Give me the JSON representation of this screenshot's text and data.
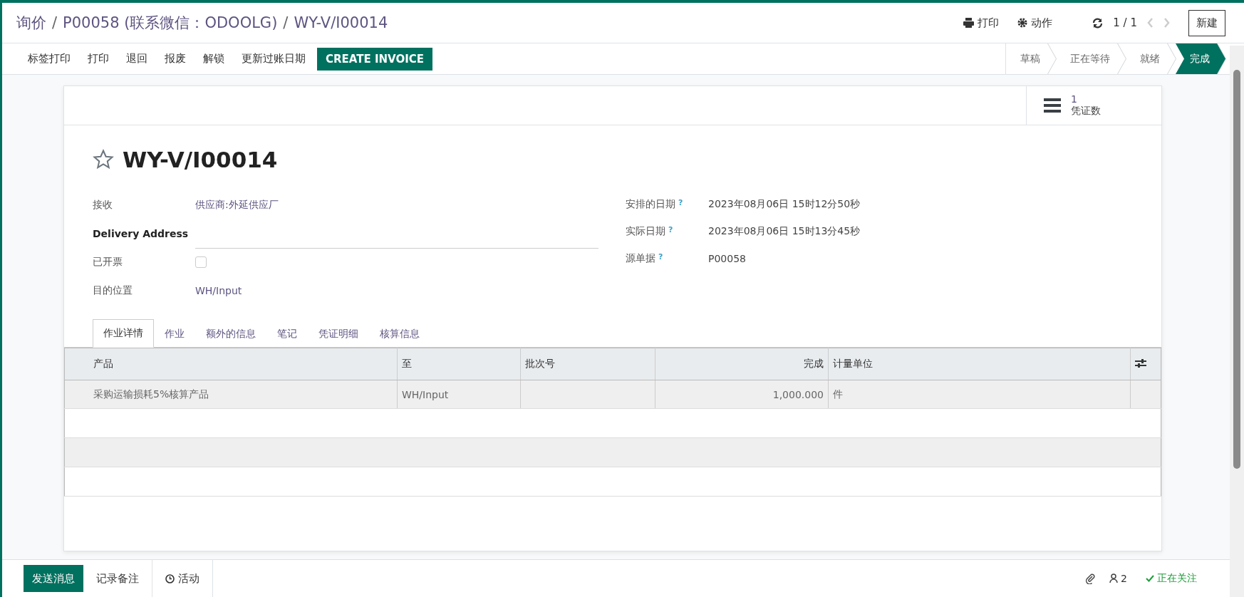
{
  "breadcrumb": {
    "separator": "/",
    "items": [
      {
        "label": "询价"
      },
      {
        "label": "P00058 (联系微信：ODOOLG)"
      },
      {
        "label": "WY-V/I00014"
      }
    ]
  },
  "header_actions": [
    {
      "kind": "print",
      "label": "打印"
    },
    {
      "kind": "gear",
      "label": "动作"
    }
  ],
  "pager": {
    "value": "1 / 1"
  },
  "new_button": "新建",
  "action_buttons": [
    {
      "label": "标签打印",
      "kind": "plain"
    },
    {
      "label": "打印",
      "kind": "plain"
    },
    {
      "label": "退回",
      "kind": "plain"
    },
    {
      "label": "报废",
      "kind": "plain"
    },
    {
      "label": "解锁",
      "kind": "plain"
    },
    {
      "label": "更新过账日期",
      "kind": "plain"
    },
    {
      "label": "CREATE INVOICE",
      "kind": "primary"
    }
  ],
  "stages": [
    {
      "label": "草稿",
      "selected": false
    },
    {
      "label": "正在等待",
      "selected": false
    },
    {
      "label": "就绪",
      "selected": false
    },
    {
      "label": "完成",
      "selected": true
    }
  ],
  "smart_button": {
    "count": "1",
    "label": "凭证数"
  },
  "record": {
    "title": "WY-V/I00014",
    "starred": false
  },
  "left_fields": [
    {
      "kind": "link",
      "label": "接收",
      "value": "供应商:外延供应厂"
    },
    {
      "kind": "input",
      "label": "Delivery Address"
    },
    {
      "kind": "checkbox",
      "label": "已开票",
      "checked": false
    },
    {
      "kind": "link",
      "label": "目的位置",
      "value": "WH/Input"
    }
  ],
  "right_fields": [
    {
      "label": "安排的日期",
      "help": "?",
      "value": "2023年08月06日 15时12分50秒"
    },
    {
      "label": "实际日期",
      "help": "?",
      "value": "2023年08月06日 15时13分45秒"
    },
    {
      "label": "源单据",
      "help": "?",
      "value": "P00058"
    }
  ],
  "tabs": [
    {
      "label": "作业详情",
      "selected": true
    },
    {
      "label": "作业",
      "selected": false
    },
    {
      "label": "额外的信息",
      "selected": false
    },
    {
      "label": "笔记",
      "selected": false
    },
    {
      "label": "凭证明细",
      "selected": false
    },
    {
      "label": "核算信息",
      "selected": false
    }
  ],
  "table": {
    "columns": [
      {
        "label": "产品",
        "kind": "text"
      },
      {
        "label": "至",
        "kind": "text"
      },
      {
        "label": "批次号",
        "kind": "text"
      },
      {
        "label": "完成",
        "kind": "number"
      },
      {
        "label": "计量单位",
        "kind": "text"
      }
    ],
    "rows": [
      [
        "采购运输损耗5%核算产品",
        "WH/Input",
        "",
        "1,000.000",
        "件"
      ]
    ]
  },
  "chatter": {
    "buttons": [
      {
        "label": "发送消息",
        "kind": "primary"
      },
      {
        "label": "记录备注",
        "kind": "plain"
      },
      {
        "label": "活动",
        "kind": "clock"
      }
    ],
    "followers": "2",
    "following": "正在关注"
  }
}
